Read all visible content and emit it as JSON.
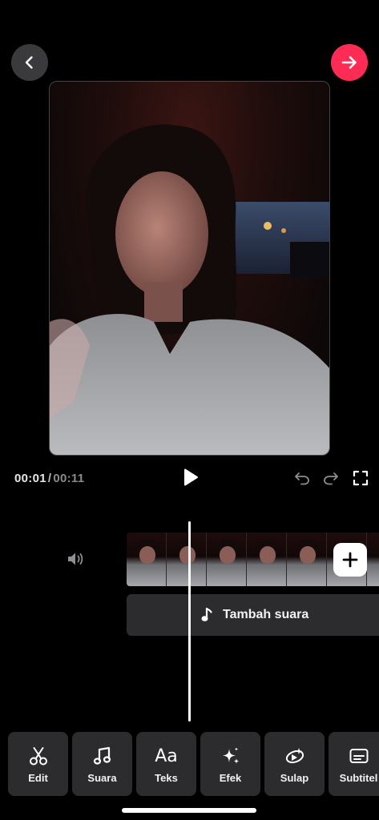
{
  "colors": {
    "background": "#000000",
    "accent": "#fe2c55",
    "surface": "#2c2c2e",
    "back_button": "#3a3a3c"
  },
  "header": {
    "back_icon": "chevron-left-icon",
    "next_icon": "arrow-right-icon"
  },
  "preview": {
    "content": "video-frame"
  },
  "playback": {
    "current_time": "00:01",
    "separator": "/",
    "total_time": "00:11",
    "play_icon": "play-icon",
    "undo_icon": "undo-icon",
    "redo_icon": "redo-icon",
    "fullscreen_icon": "fullscreen-icon"
  },
  "timeline": {
    "mute_icon": "speaker-icon",
    "add_clip_icon": "plus-icon",
    "add_sound_label": "Tambah suara",
    "add_sound_icon": "music-note-icon"
  },
  "toolbar": {
    "tools": [
      {
        "label": "Edit",
        "icon": "scissors-icon"
      },
      {
        "label": "Suara",
        "icon": "music-note-icon"
      },
      {
        "label": "Teks",
        "icon": "text-aa-icon",
        "glyph": "Aa"
      },
      {
        "label": "Efek",
        "icon": "sparkle-icon"
      },
      {
        "label": "Sulap",
        "icon": "magic-icon"
      },
      {
        "label": "Subtitel",
        "icon": "subtitle-icon"
      }
    ]
  }
}
